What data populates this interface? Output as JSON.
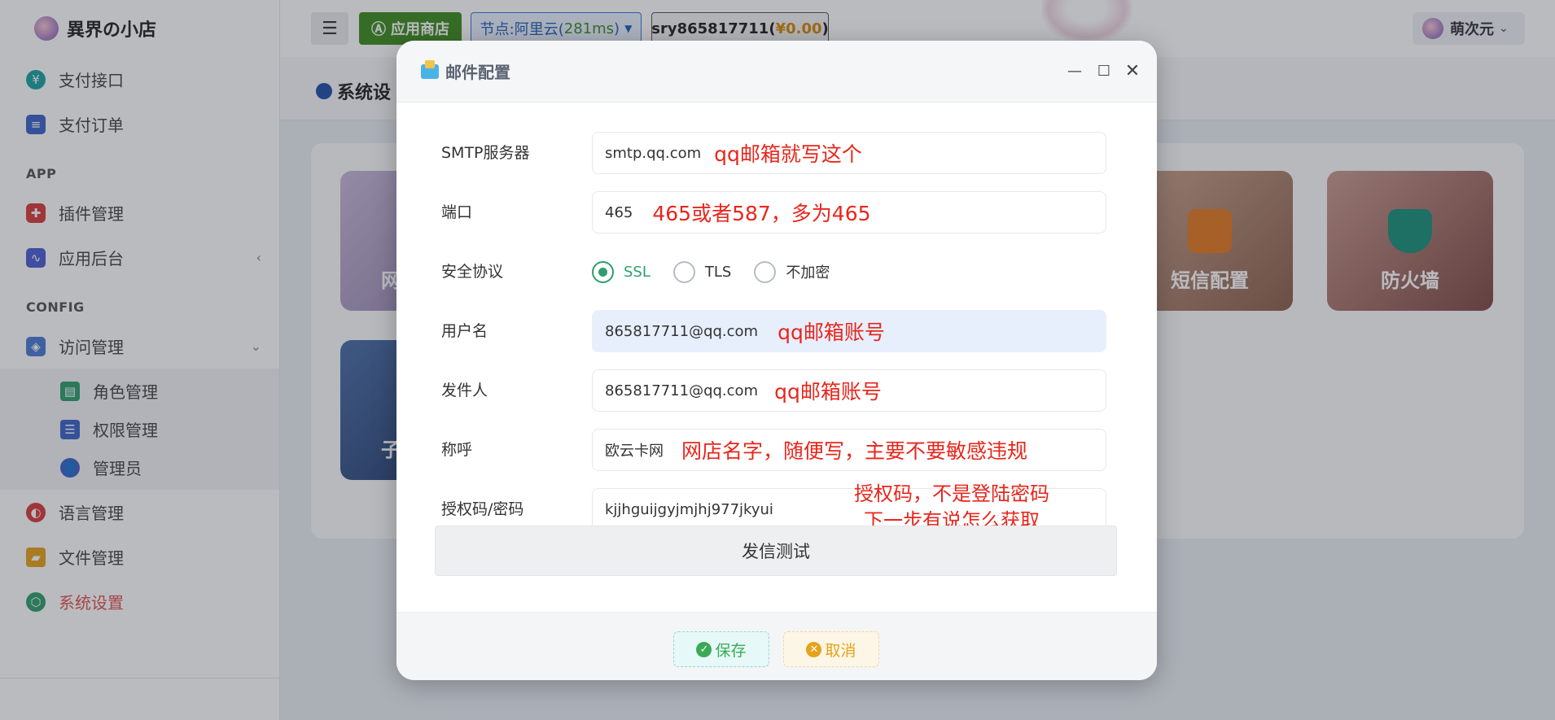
{
  "sidebar": {
    "brand": "異界の小店",
    "items_top": [
      {
        "label": "支付接口",
        "icon": "yen-circle-icon",
        "color": "#1aa3a3"
      },
      {
        "label": "支付订单",
        "icon": "order-icon",
        "color": "#3a63c8"
      }
    ],
    "section_app": "APP",
    "items_app": [
      {
        "label": "插件管理",
        "icon": "puzzle-icon",
        "color": "#d63b3b"
      },
      {
        "label": "应用后台",
        "icon": "chart-icon",
        "color": "#4a5fd1"
      }
    ],
    "section_config": "CONFIG",
    "access": {
      "label": "访问管理",
      "icon": "shield-icon"
    },
    "sub_items": [
      {
        "label": "角色管理",
        "icon": "role-icon"
      },
      {
        "label": "权限管理",
        "icon": "permission-icon"
      },
      {
        "label": "管理员",
        "icon": "admin-icon"
      }
    ],
    "items_bottom": [
      {
        "label": "语言管理",
        "icon": "globe-icon"
      },
      {
        "label": "文件管理",
        "icon": "folder-icon"
      },
      {
        "label": "系统设置",
        "icon": "settings-icon"
      }
    ]
  },
  "topbar": {
    "store_label": "应用商店",
    "node_prefix": "节点:阿里云(",
    "node_ms": "281ms",
    "node_suffix": ")",
    "user_name": "sry865817711(",
    "user_money": "¥0.00",
    "user_suffix": ")",
    "profile_name": "萌次元"
  },
  "main": {
    "page_title": "系统设",
    "cards": [
      {
        "label": "网"
      },
      {
        "label": "短信配置",
        "icon": "sms-settings-icon"
      },
      {
        "label": "防火墙",
        "icon": "firewall-icon"
      },
      {
        "label": "子"
      }
    ]
  },
  "modal": {
    "title": "邮件配置",
    "fields": {
      "smtp": {
        "label": "SMTP服务器",
        "value": "smtp.qq.com",
        "note": "qq邮箱就写这个"
      },
      "port": {
        "label": "端口",
        "value": "465",
        "note": "465或者587，多为465"
      },
      "security": {
        "label": "安全协议",
        "options": [
          "SSL",
          "TLS",
          "不加密"
        ],
        "selected": "SSL"
      },
      "username": {
        "label": "用户名",
        "value": "865817711@qq.com",
        "note": "qq邮箱账号"
      },
      "sender": {
        "label": "发件人",
        "value": "865817711@qq.com",
        "note": "qq邮箱账号"
      },
      "nickname": {
        "label": "称呼",
        "value": "欧云卡网",
        "note": "网店名字，随便写，主要不要敏感违规"
      },
      "authcode": {
        "label": "授权码/密码",
        "value": "kjjhguijgyjmjhj977jkyui",
        "note_line1": "授权码，不是登陆密码",
        "note_line2": "下一步有说怎么获取"
      }
    },
    "test_button": "发信测试",
    "save_button": "保存",
    "cancel_button": "取消"
  }
}
